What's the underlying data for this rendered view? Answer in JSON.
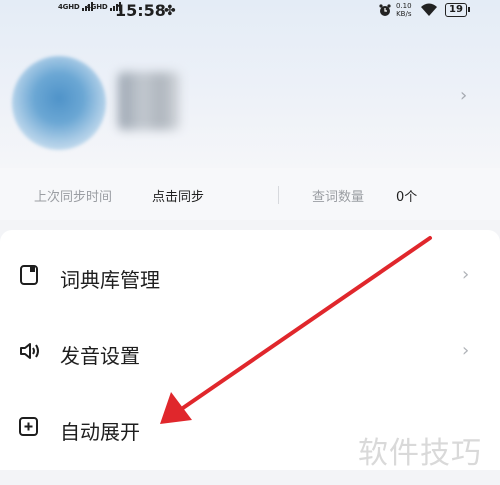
{
  "status_bar": {
    "sim1": "4GHD",
    "sim2": "4GHD",
    "time": "15:58",
    "net_speed_value": "0.10",
    "net_speed_unit": "KB/s",
    "battery": "19"
  },
  "sync_bar": {
    "last_sync_label": "上次同步时间",
    "sync_action": "点击同步",
    "lookup_count_label": "查词数量",
    "lookup_count_value": "0个"
  },
  "menu": {
    "items": [
      {
        "label": "词典库管理",
        "icon": "dictionary-icon",
        "has_chevron": true
      },
      {
        "label": "发音设置",
        "icon": "speaker-icon",
        "has_chevron": true
      },
      {
        "label": "自动展开",
        "icon": "expand-plus-icon",
        "has_chevron": false
      }
    ]
  },
  "annotation_color": "#e0272c",
  "watermark": "软件技巧"
}
